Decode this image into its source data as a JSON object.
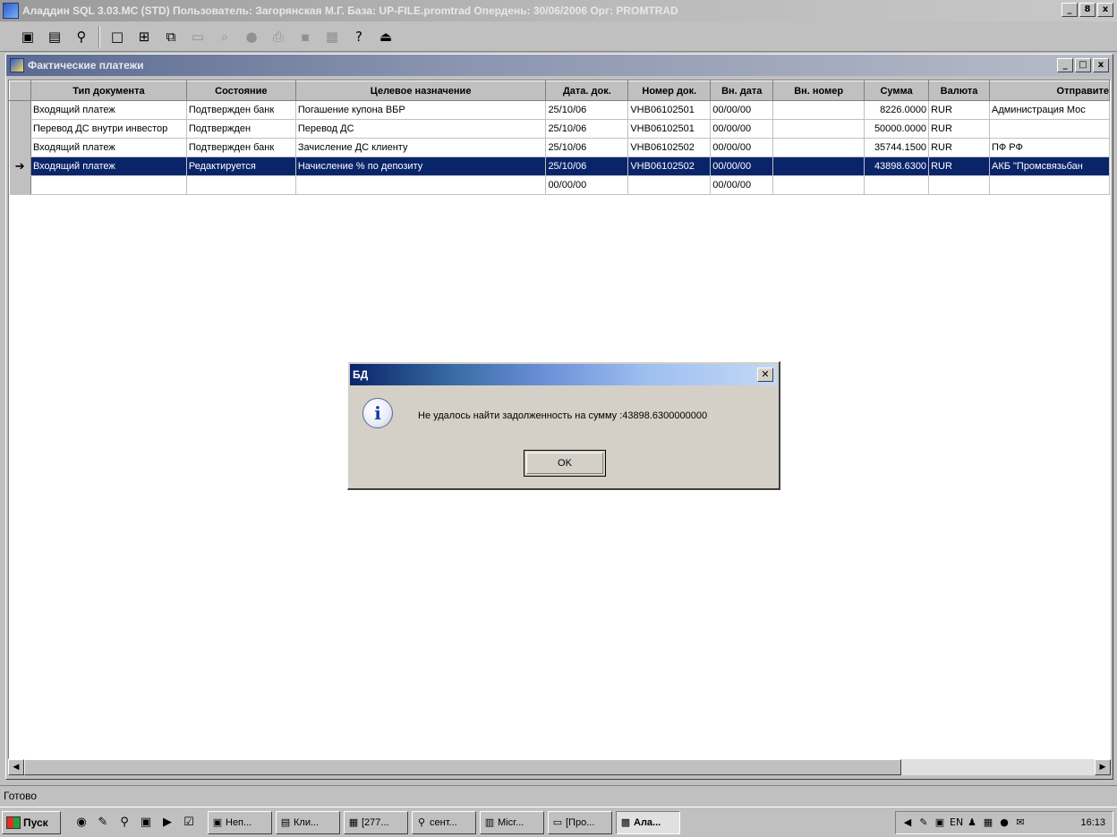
{
  "app": {
    "title": "Аладдин SQL 3.03.MC (STD)  Пользователь: Загорянская М.Г. База: UP-FILE.promtrad Опердень: 30/06/2006 Орг: PROMTRAD"
  },
  "window_controls": {
    "minimize": "_",
    "restore": "8",
    "close": "x"
  },
  "toolbar": {
    "icons": [
      "calculator-icon",
      "book-icon",
      "search-person-icon",
      "window-icon",
      "grid-icon",
      "cascade-icon",
      "blank-window-icon",
      "binoculars-icon",
      "record-icon",
      "print-icon",
      "save-icon",
      "calendar-icon",
      "help-icon",
      "exit-icon"
    ],
    "glyphs": [
      "▣",
      "▤",
      "⚲",
      "□",
      "⊞",
      "⧉",
      "▭",
      "⌕",
      "●",
      "⎙",
      "▪",
      "▦",
      "?",
      "⏏"
    ]
  },
  "child_window": {
    "title": "Фактические платежи"
  },
  "grid": {
    "columns": [
      "Тип документа",
      "Состояние",
      "Целевое назначение",
      "Дата. док.",
      "Номер док.",
      "Вн. дата",
      "Вн. номер",
      "Сумма",
      "Валюта",
      "Отправите"
    ],
    "rows": [
      {
        "indicator": "",
        "cells": [
          "Входящий платеж",
          "Подтвержден банк",
          "Погашение купона ВБР",
          "25/10/06",
          "VHB06102501",
          "00/00/00",
          "",
          "8226.0000",
          "RUR",
          "Администрация Мос"
        ]
      },
      {
        "indicator": "",
        "cells": [
          "Перевод ДС внутри инвестор",
          "Подтвержден",
          "Перевод ДС",
          "25/10/06",
          "VHB06102501",
          "00/00/00",
          "",
          "50000.0000",
          "RUR",
          ""
        ]
      },
      {
        "indicator": "",
        "cells": [
          "Входящий платеж",
          "Подтвержден банк",
          "Зачисление ДС клиенту",
          "25/10/06",
          "VHB06102502",
          "00/00/00",
          "",
          "35744.1500",
          "RUR",
          "ПФ РФ"
        ]
      },
      {
        "indicator": "➔",
        "cells": [
          "Входящий платеж",
          "Редактируется",
          "Начисление % по депозиту",
          "25/10/06",
          "VHB06102502",
          "00/00/00",
          "",
          "43898.6300",
          "RUR",
          "АКБ \"Промсвязьбан"
        ]
      },
      {
        "indicator": "",
        "cells": [
          "",
          "",
          "",
          "00/00/00",
          "",
          "00/00/00",
          "",
          "",
          "",
          ""
        ]
      }
    ]
  },
  "scrollbar": {
    "left_arrow": "◀",
    "right_arrow": "▶"
  },
  "status": {
    "text": "Готово"
  },
  "dialog": {
    "title": "БД",
    "close": "✕",
    "icon_glyph": "i",
    "message": "Не удалось найти задолженность на сумму :43898.6300000000",
    "ok_label": "OK"
  },
  "taskbar": {
    "start_label": "Пуск",
    "quicklaunch": [
      "◉",
      "✎",
      "⚲",
      "▣",
      "▶",
      "☑"
    ],
    "tasks": [
      {
        "label": "Неп...",
        "glyph": "▣"
      },
      {
        "label": "Кли...",
        "glyph": "▤"
      },
      {
        "label": "[277...",
        "glyph": "▦"
      },
      {
        "label": "сент...",
        "glyph": "⚲"
      },
      {
        "label": "Micr...",
        "glyph": "▥"
      },
      {
        "label": "[Про...",
        "glyph": "▭"
      },
      {
        "label": "Ала...",
        "glyph": "▩"
      }
    ],
    "tray": [
      "◀",
      "✎",
      "▣",
      "EN",
      "♟",
      "▦",
      "●",
      "✉"
    ],
    "clock": "16:13"
  }
}
